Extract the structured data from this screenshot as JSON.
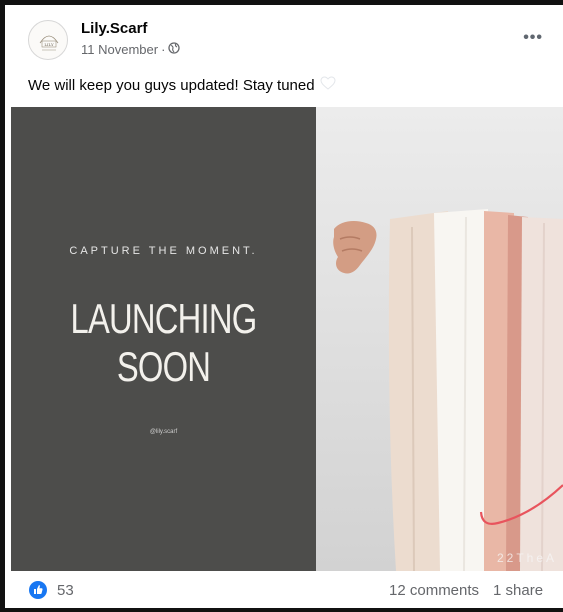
{
  "post": {
    "author": "Lily.Scarf",
    "date": "11 November",
    "separator": "·",
    "caption": "We will keep you guys updated! Stay tuned",
    "avatar_text": "LILY"
  },
  "image": {
    "tagline": "CAPTURE THE MOMENT.",
    "headline_line1": "LAUNCHING",
    "headline_line2": "SOON",
    "handle": "@lily.scarf",
    "watermark": "22TheA"
  },
  "stats": {
    "likes": "53",
    "comments": "12 comments",
    "shares": "1 share"
  },
  "colors": {
    "panel": "#4d4d4b",
    "like_blue": "#1877f2",
    "annotation_red": "#e8545d"
  },
  "icons": {
    "globe": "globe-icon",
    "more": "more-options-icon",
    "like": "like-icon",
    "heart": "heart-emoji-icon"
  }
}
